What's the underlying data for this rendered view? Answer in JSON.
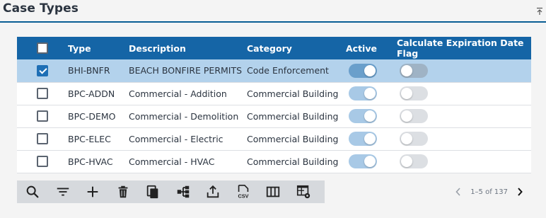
{
  "page": {
    "title": "Case Types"
  },
  "grid": {
    "columns": {
      "type": "Type",
      "description": "Description",
      "category": "Category",
      "active": "Active",
      "calc_exp": "Calculate Expiration Date Flag"
    },
    "rows": [
      {
        "type": "BHI-BNFR",
        "description": "BEACH BONFIRE PERMITS",
        "category": "Code Enforcement",
        "checked": true,
        "active": true,
        "calc_exp": false
      },
      {
        "type": "BPC-ADDN",
        "description": "Commercial - Addition",
        "category": "Commercial Building",
        "checked": false,
        "active": true,
        "calc_exp": false
      },
      {
        "type": "BPC-DEMO",
        "description": "Commercial - Demolition",
        "category": "Commercial Building",
        "checked": false,
        "active": true,
        "calc_exp": false
      },
      {
        "type": "BPC-ELEC",
        "description": "Commercial - Electric",
        "category": "Commercial Building",
        "checked": false,
        "active": true,
        "calc_exp": false
      },
      {
        "type": "BPC-HVAC",
        "description": "Commercial - HVAC",
        "category": "Commercial Building",
        "checked": false,
        "active": true,
        "calc_exp": false
      }
    ]
  },
  "toolbar": {
    "buttons": [
      "search-icon",
      "filter-icon",
      "add-icon",
      "delete-icon",
      "copy-icon",
      "hierarchy-icon",
      "export-icon",
      "csv-icon",
      "columns-icon",
      "grid-settings-icon"
    ],
    "csv_label": "CSV"
  },
  "pager": {
    "info": "1–5 of 137"
  },
  "colors": {
    "header": "#1565a6",
    "selected_row": "#b3d2ec",
    "accent": "#0a5e94"
  }
}
